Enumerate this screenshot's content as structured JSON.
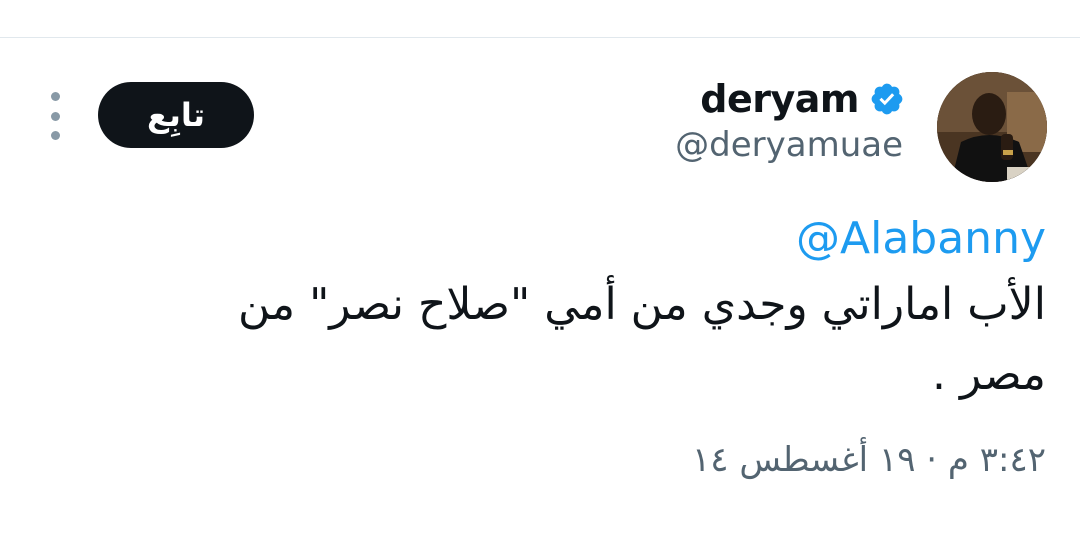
{
  "tweet": {
    "author": {
      "display_name": "deryam",
      "handle": "@deryamuae",
      "verified": true,
      "verified_color": "#1d9bf0"
    },
    "follow_label": "تابِع",
    "more_icon": "more-options-icon",
    "mention": "@Alabanny",
    "text": "الأب اماراتي وجدي من أمي \"صلاح نصر\" من مصر .",
    "timestamp": "٣:٤٢ م · ١٩ أغسطس ١٤"
  },
  "colors": {
    "text": "#0f1419",
    "secondary": "#536471",
    "link": "#1d9bf0",
    "button_bg": "#0f1419"
  }
}
